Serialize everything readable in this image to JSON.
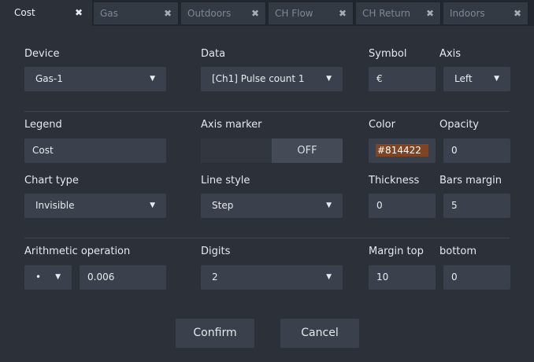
{
  "tabs": [
    {
      "label": "Cost",
      "close": "✖"
    },
    {
      "label": "Gas",
      "close": "✖"
    },
    {
      "label": "Outdoors",
      "close": "✖"
    },
    {
      "label": "CH Flow",
      "close": "✖"
    },
    {
      "label": "CH Return",
      "close": "✖"
    },
    {
      "label": "Indoors",
      "close": "✖"
    }
  ],
  "form": {
    "device": {
      "label": "Device",
      "value": "Gas-1"
    },
    "data": {
      "label": "Data",
      "value": "[Ch1] Pulse count 1"
    },
    "symbol": {
      "label": "Symbol",
      "value": "€"
    },
    "axis": {
      "label": "Axis",
      "value": "Left"
    },
    "legend": {
      "label": "Legend",
      "value": "Cost"
    },
    "axis_marker": {
      "label": "Axis marker",
      "value": "OFF"
    },
    "color": {
      "label": "Color",
      "value": "#814422",
      "swatch": "#814422"
    },
    "opacity": {
      "label": "Opacity",
      "value": "0"
    },
    "chart_type": {
      "label": "Chart type",
      "value": "Invisible"
    },
    "line_style": {
      "label": "Line style",
      "value": "Step"
    },
    "thickness": {
      "label": "Thickness",
      "value": "0"
    },
    "bars_margin": {
      "label": "Bars margin",
      "value": "5"
    },
    "arithmetic_operation": {
      "label": "Arithmetic operation",
      "operator": "•",
      "value": "0.006"
    },
    "digits": {
      "label": "Digits",
      "value": "2"
    },
    "margin_top": {
      "label": "Margin top",
      "value": "10"
    },
    "margin_bottom": {
      "label": "bottom",
      "value": "0"
    }
  },
  "buttons": {
    "confirm": "Confirm",
    "cancel": "Cancel"
  },
  "icons": {
    "dropdown": "▼"
  },
  "colors": {
    "background": "#2b3039",
    "field": "#3b414c",
    "swatch": "#814422"
  }
}
